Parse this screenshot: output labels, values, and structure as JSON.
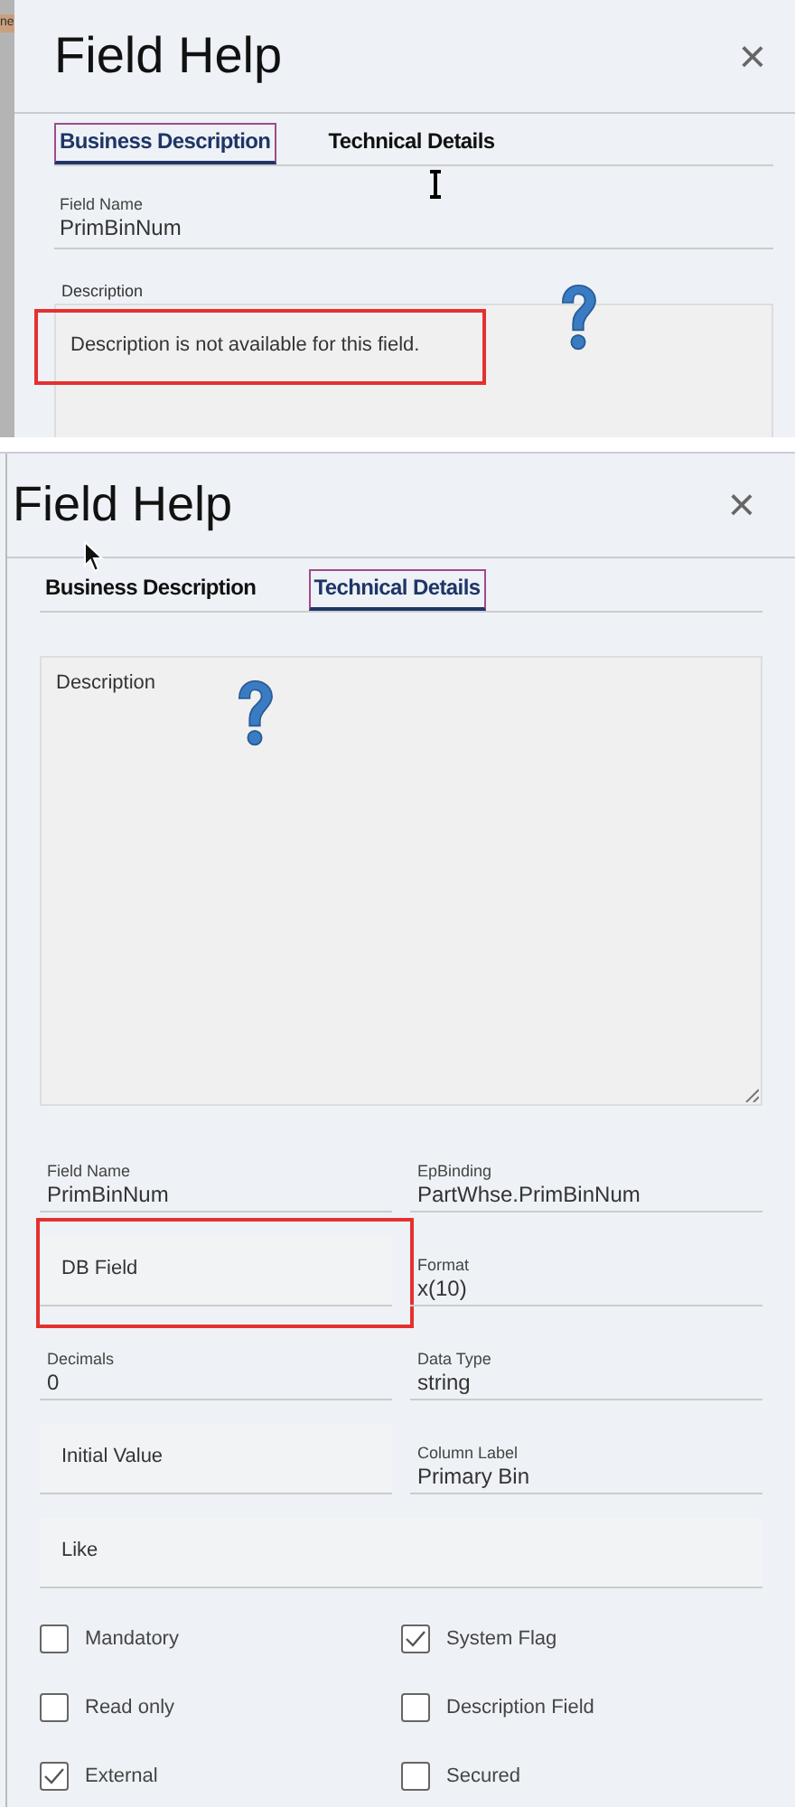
{
  "panels": [
    {
      "edge_text": "ne",
      "title": "Field Help",
      "close": "×",
      "tabs": [
        {
          "label": "Business Description",
          "selected": true
        },
        {
          "label": "Technical Details",
          "selected": false
        }
      ],
      "fields": [
        {
          "label": "Field Name",
          "value": "PrimBinNum"
        }
      ],
      "description": {
        "label": "Description",
        "text": "Description is not available for this field.",
        "highlighted": true
      }
    },
    {
      "title": "Field Help",
      "close": "×",
      "tabs": [
        {
          "label": "Business Description",
          "selected": false
        },
        {
          "label": "Technical Details",
          "selected": true
        }
      ],
      "description": {
        "label": "Description"
      },
      "fields": [
        {
          "label": "Field Name",
          "value": "PrimBinNum"
        },
        {
          "label": "EpBinding",
          "value": "PartWhse.PrimBinNum"
        },
        {
          "label": "DB Field",
          "highlighted": true
        },
        {
          "label": "Format",
          "value": "x(10)"
        },
        {
          "label": "Decimals",
          "value": "0"
        },
        {
          "label": "Data Type",
          "value": "string"
        },
        {
          "label": "Initial Value"
        },
        {
          "label": "Column Label",
          "value": "Primary Bin"
        },
        {
          "label": "Like",
          "full_width": true
        }
      ],
      "checkboxes": [
        {
          "label": "Mandatory",
          "checked": false
        },
        {
          "label": "System Flag",
          "checked": true
        },
        {
          "label": "Read only",
          "checked": false
        },
        {
          "label": "Description Field",
          "checked": false
        },
        {
          "label": "External",
          "checked": true
        },
        {
          "label": "Secured",
          "checked": false
        }
      ]
    }
  ]
}
